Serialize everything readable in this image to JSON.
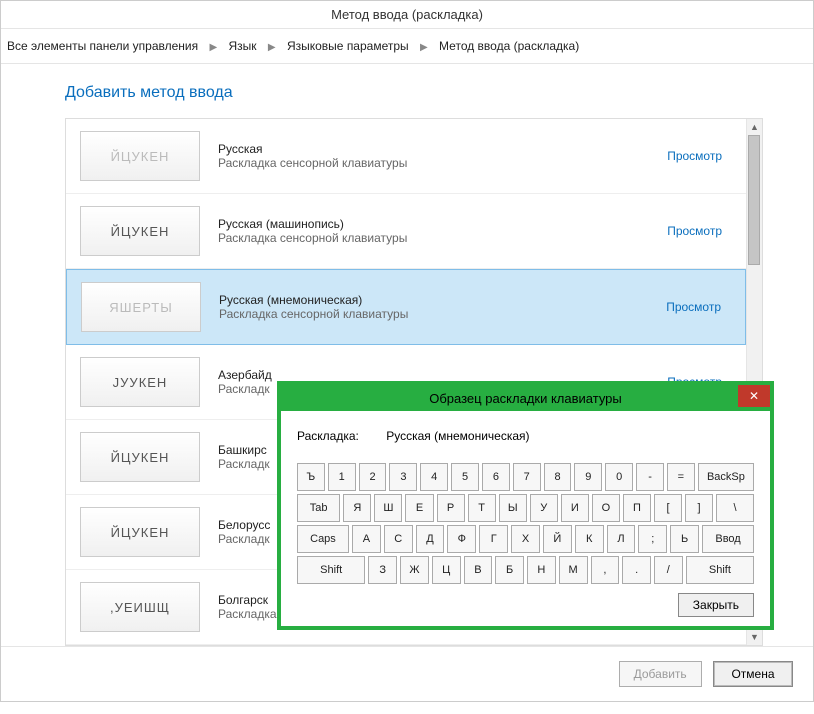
{
  "window": {
    "title": "Метод ввода (раскладка)"
  },
  "breadcrumb": [
    "Все элементы панели управления",
    "Язык",
    "Языковые параметры",
    "Метод ввода (раскладка)"
  ],
  "heading": "Добавить метод ввода",
  "preview_label": "Просмотр",
  "items": [
    {
      "thumb": "ЙЦУКЕН",
      "disabled_thumb": true,
      "name": "Русская",
      "sub": "Раскладка сенсорной клавиатуры"
    },
    {
      "thumb": "ЙЦУКЕН",
      "name": "Русская (машинопись)",
      "sub": "Раскладка сенсорной клавиатуры"
    },
    {
      "thumb": "ЯШЕРТЫ",
      "disabled_thumb": true,
      "name": "Русская (мнемоническая)",
      "sub": "Раскладка сенсорной клавиатуры",
      "selected": true
    },
    {
      "thumb": "JУУКЕН",
      "name": "Азербайд",
      "sub": "Раскладк"
    },
    {
      "thumb": "ЙЦУКЕН",
      "name": "Башкирс",
      "sub": "Раскладк"
    },
    {
      "thumb": "ЙЦУКЕН",
      "name": "Белорусс",
      "sub": "Раскладк"
    },
    {
      "thumb": ",УЕИШЩ",
      "name": "Болгарск",
      "sub": "Раскладка сенсорной клавиатуры"
    }
  ],
  "footer": {
    "add": "Добавить",
    "cancel": "Отмена"
  },
  "popup": {
    "title": "Образец раскладки клавиатуры",
    "layout_label": "Раскладка:",
    "layout_name": "Русская (мнемоническая)",
    "close_btn": "Закрыть",
    "rows": [
      [
        "Ъ",
        "1",
        "2",
        "3",
        "4",
        "5",
        "6",
        "7",
        "8",
        "9",
        "0",
        "-",
        "=",
        "BackSp"
      ],
      [
        "Tab",
        "Я",
        "Ш",
        "Е",
        "Р",
        "Т",
        "Ы",
        "У",
        "И",
        "О",
        "П",
        "[",
        "]",
        "\\"
      ],
      [
        "Caps",
        "А",
        "С",
        "Д",
        "Ф",
        "Г",
        "Х",
        "Й",
        "К",
        "Л",
        ";",
        "Ь",
        "Ввод"
      ],
      [
        "Shift",
        "З",
        "Ж",
        "Ц",
        "В",
        "Б",
        "Н",
        "М",
        ",",
        ".",
        "/",
        "Shift"
      ]
    ]
  }
}
